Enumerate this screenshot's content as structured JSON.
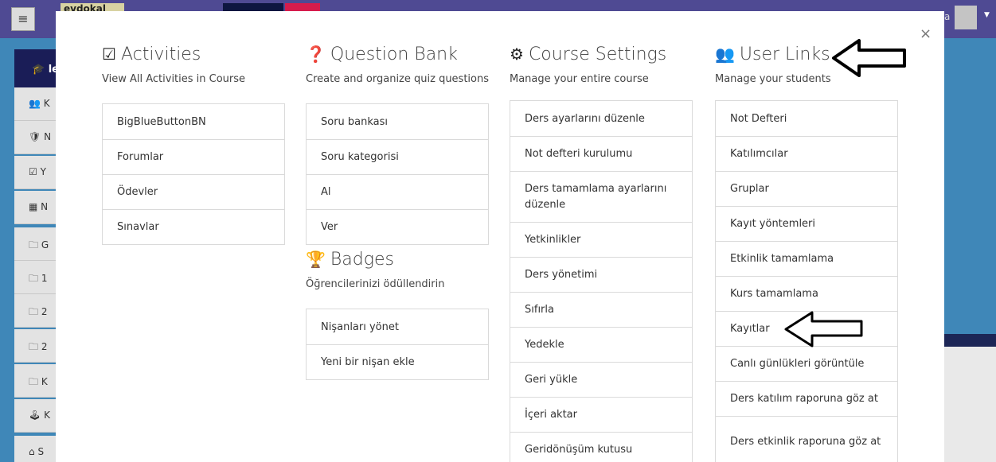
{
  "topbar": {
    "menu_icon": "hamburger-icon",
    "logo_text": "evdokal",
    "user_fragment": "a"
  },
  "drawer": {
    "header_label": "le",
    "items": [
      {
        "icon": "users-icon",
        "glyph": "👥",
        "label": "K"
      },
      {
        "icon": "shield-icon",
        "glyph": "🛡",
        "label": "N"
      },
      {
        "icon": "check-square-icon",
        "glyph": "☑",
        "label": "Y"
      },
      {
        "icon": "table-icon",
        "glyph": "▦",
        "label": "N"
      },
      {
        "icon": "folder-icon",
        "glyph": "🗀",
        "label": "G"
      },
      {
        "icon": "folder-icon",
        "glyph": "🗀",
        "label": "1"
      },
      {
        "icon": "folder-icon",
        "glyph": "🗀",
        "label": "2"
      },
      {
        "icon": "folder-icon",
        "glyph": "🗀",
        "label": "2"
      },
      {
        "icon": "folder-icon",
        "glyph": "🗀",
        "label": "K"
      },
      {
        "icon": "dashboard-icon",
        "glyph": "🕹",
        "label": "K"
      },
      {
        "icon": "home-icon",
        "glyph": "⌂",
        "label": "S"
      }
    ]
  },
  "modal": {
    "close": "×",
    "activities": {
      "title": "Activities",
      "icon": "check-square-icon",
      "glyph": "☑",
      "desc": "View All Activities in Course",
      "items": [
        "BigBlueButtonBN",
        "Forumlar",
        "Ödevler",
        "Sınavlar"
      ]
    },
    "question_bank": {
      "title": "Question Bank",
      "icon": "question-circle-icon",
      "glyph": "❓",
      "desc": "Create and organize quiz questions",
      "items": [
        "Soru bankası",
        "Soru kategorisi",
        "Al",
        "Ver"
      ]
    },
    "badges": {
      "title": "Badges",
      "icon": "trophy-icon",
      "glyph": "🏆",
      "desc": "Öğrencilerinizi ödüllendirin",
      "items": [
        "Nişanları yönet",
        "Yeni bir nişan ekle"
      ]
    },
    "course_settings": {
      "title": "Course Settings",
      "icon": "cogs-icon",
      "glyph": "⚙",
      "desc": "Manage your entire course",
      "items": [
        "Ders ayarlarını düzenle",
        "Not defteri kurulumu",
        "Ders tamamlama ayarlarını düzenle",
        "Yetkinlikler",
        "Ders yönetimi",
        "Sıfırla",
        "Yedekle",
        "Geri yükle",
        "İçeri aktar",
        "Geridönüşüm kutusu"
      ]
    },
    "user_links": {
      "title": "User Links",
      "icon": "users-icon",
      "glyph": "👥",
      "desc": "Manage your students",
      "items": [
        "Not Defteri",
        "Katılımcılar",
        "Gruplar",
        "Kayıt yöntemleri",
        "Etkinlik tamamlama",
        "Kurs tamamlama",
        "Kayıtlar",
        "Canlı günlükleri görüntüle",
        "Ders katılım raporuna göz at",
        "Ders etkinlik raporuna göz at"
      ]
    }
  }
}
